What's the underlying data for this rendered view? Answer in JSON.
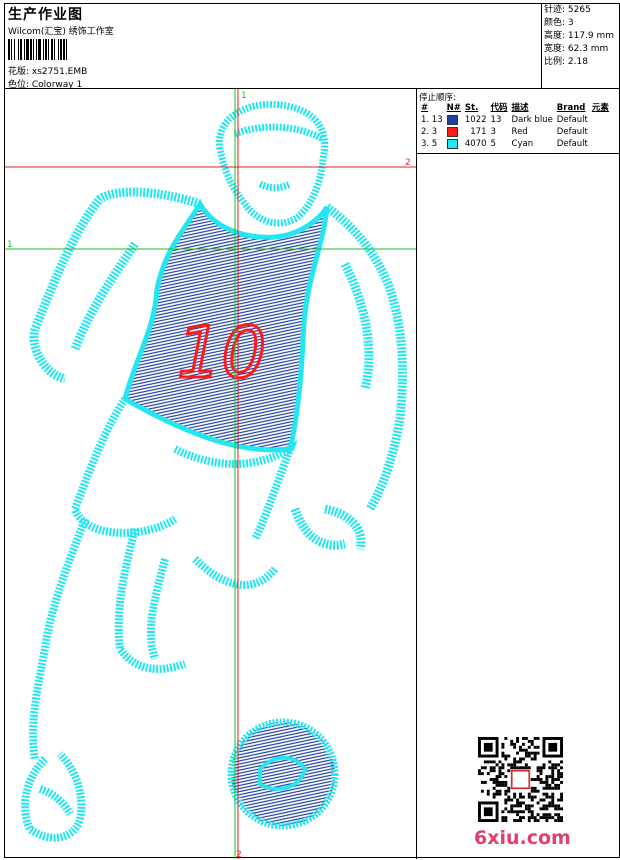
{
  "header": {
    "title": "生产作业图",
    "software": "Wilcom(汇宝) 绣饰工作室",
    "design_label": "花版: xs2751.EMB",
    "colorway_label": "色位: Colorway 1"
  },
  "stats": {
    "stitches": "针迹: 5265",
    "colors": "颜色: 3",
    "height": "高度: 117.9 mm",
    "width": "宽度: 62.3 mm",
    "scale": "比例: 2.18"
  },
  "stop_sequence": {
    "title": "停止顺序:",
    "headers": [
      "#",
      "N#",
      "St.",
      "代码",
      "描述",
      "Brand",
      "元素"
    ],
    "rows": [
      {
        "num": "1. 13",
        "color": "#1f3fa0",
        "stitches": "1022",
        "code": "13",
        "desc": "Dark blue",
        "brand": "Default"
      },
      {
        "num": "2. 3",
        "color": "#ff1a1a",
        "stitches": "171",
        "code": "3",
        "desc": "Red",
        "brand": "Default"
      },
      {
        "num": "3. 5",
        "color": "#22e6f0",
        "stitches": "4070",
        "code": "5",
        "desc": "Cyan",
        "brand": "Default"
      }
    ]
  },
  "guides": {
    "green_label": "1",
    "red_label": "2",
    "green_color": "#18c418",
    "red_color": "#e02020"
  },
  "design": {
    "jersey_number": "10",
    "outline_color": "#22e6f0",
    "fill_color": "#1f3fa0",
    "number_color": "#ff1a1a"
  },
  "watermark": {
    "logo_text": "6xiu.com"
  }
}
